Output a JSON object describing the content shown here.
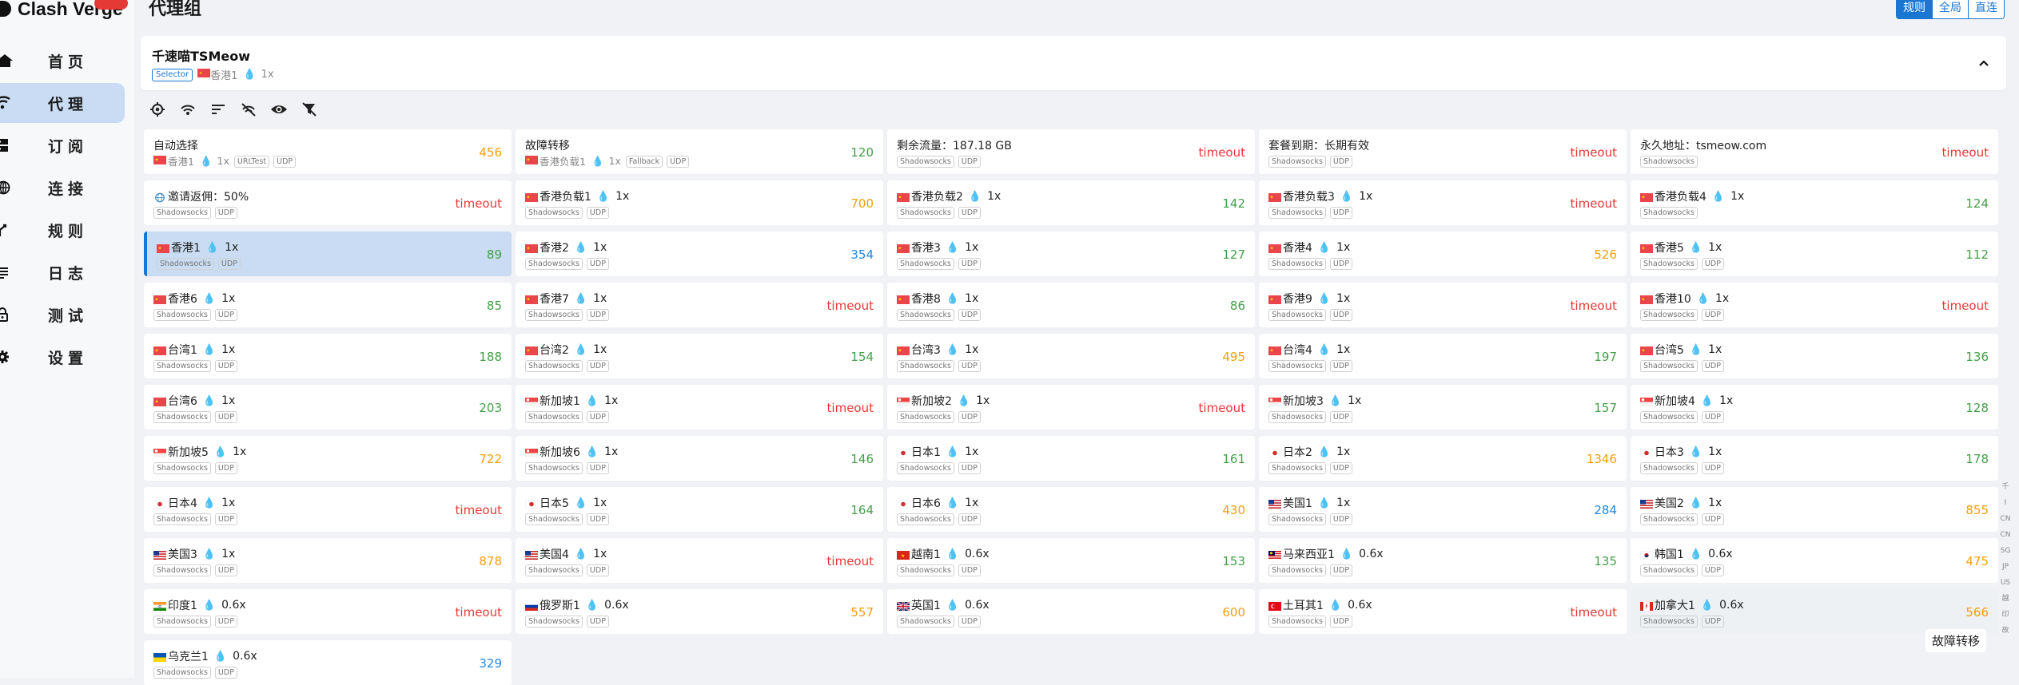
{
  "app": {
    "name": "Clash Verge"
  },
  "header": {
    "title": "代理组"
  },
  "mode_switch": [
    {
      "label": "规则",
      "active": true
    },
    {
      "label": "全局",
      "active": false
    },
    {
      "label": "直连",
      "active": false
    }
  ],
  "nav": [
    {
      "label": "首页",
      "icon": "home-icon",
      "active": false
    },
    {
      "label": "代理",
      "icon": "wifi-icon",
      "active": true
    },
    {
      "label": "订阅",
      "icon": "dns-icon",
      "active": false
    },
    {
      "label": "连接",
      "icon": "language-icon",
      "active": false
    },
    {
      "label": "规则",
      "icon": "fork-icon",
      "active": false
    },
    {
      "label": "日志",
      "icon": "subject-icon",
      "active": false
    },
    {
      "label": "测试",
      "icon": "lock-icon",
      "active": false
    },
    {
      "label": "设置",
      "icon": "gear-icon",
      "active": false
    }
  ],
  "group": {
    "name": "千速喵TSMeow",
    "type": "Selector",
    "current": "香港1",
    "current_flag": "cn",
    "multiplier": "1x"
  },
  "toolbar": [
    "locate-icon",
    "wifi-tethering-icon",
    "sort-icon",
    "hide-icon",
    "eye-icon",
    "filter-off-icon"
  ],
  "colors": {
    "accent": "#1976d2",
    "selected_bg": "#c9dcf3",
    "delay_good": "#43a047",
    "delay_mid": "#f59e0b",
    "delay_timeout": "#e53935",
    "delay_unknown": "#1e88e5"
  },
  "proxies": [
    {
      "name": "自动选择",
      "sub": "香港1",
      "flag": "cn",
      "mult": "1x",
      "tags": [
        "URLTest",
        "UDP"
      ],
      "delay": "456",
      "level": "orange"
    },
    {
      "name": "故障转移",
      "sub": "香港负载1",
      "flag": "cn",
      "mult": "1x",
      "tags": [
        "Fallback",
        "UDP"
      ],
      "delay": "120",
      "level": "green"
    },
    {
      "name": "剩余流量：187.18 GB",
      "flag": "",
      "mult": "",
      "tags": [
        "Shadowsocks",
        "UDP"
      ],
      "delay": "timeout",
      "level": "red"
    },
    {
      "name": "套餐到期：长期有效",
      "flag": "",
      "mult": "",
      "tags": [
        "Shadowsocks",
        "UDP"
      ],
      "delay": "timeout",
      "level": "red"
    },
    {
      "name": "永久地址：tsmeow.com",
      "flag": "",
      "mult": "",
      "tags": [
        "Shadowsocks"
      ],
      "delay": "timeout",
      "level": "red"
    },
    {
      "name": "邀请返佣：50%",
      "flag": "globe",
      "mult": "",
      "tags": [
        "Shadowsocks",
        "UDP"
      ],
      "delay": "timeout",
      "level": "red"
    },
    {
      "name": "香港负载1",
      "flag": "cn",
      "mult": "1x",
      "tags": [
        "Shadowsocks",
        "UDP"
      ],
      "delay": "700",
      "level": "orange"
    },
    {
      "name": "香港负载2",
      "flag": "cn",
      "mult": "1x",
      "tags": [
        "Shadowsocks",
        "UDP"
      ],
      "delay": "142",
      "level": "green"
    },
    {
      "name": "香港负载3",
      "flag": "cn",
      "mult": "1x",
      "tags": [
        "Shadowsocks",
        "UDP"
      ],
      "delay": "timeout",
      "level": "red"
    },
    {
      "name": "香港负载4",
      "flag": "cn",
      "mult": "1x",
      "tags": [
        "Shadowsocks"
      ],
      "delay": "124",
      "level": "green"
    },
    {
      "name": "香港1",
      "flag": "cn",
      "mult": "1x",
      "tags": [
        "Shadowsocks",
        "UDP"
      ],
      "delay": "89",
      "level": "green",
      "selected": true
    },
    {
      "name": "香港2",
      "flag": "cn",
      "mult": "1x",
      "tags": [
        "Shadowsocks",
        "UDP"
      ],
      "delay": "354",
      "level": "blue"
    },
    {
      "name": "香港3",
      "flag": "cn",
      "mult": "1x",
      "tags": [
        "Shadowsocks",
        "UDP"
      ],
      "delay": "127",
      "level": "green"
    },
    {
      "name": "香港4",
      "flag": "cn",
      "mult": "1x",
      "tags": [
        "Shadowsocks",
        "UDP"
      ],
      "delay": "526",
      "level": "orange"
    },
    {
      "name": "香港5",
      "flag": "cn",
      "mult": "1x",
      "tags": [
        "Shadowsocks",
        "UDP"
      ],
      "delay": "112",
      "level": "green"
    },
    {
      "name": "香港6",
      "flag": "cn",
      "mult": "1x",
      "tags": [
        "Shadowsocks",
        "UDP"
      ],
      "delay": "85",
      "level": "green"
    },
    {
      "name": "香港7",
      "flag": "cn",
      "mult": "1x",
      "tags": [
        "Shadowsocks",
        "UDP"
      ],
      "delay": "timeout",
      "level": "red"
    },
    {
      "name": "香港8",
      "flag": "cn",
      "mult": "1x",
      "tags": [
        "Shadowsocks",
        "UDP"
      ],
      "delay": "86",
      "level": "green"
    },
    {
      "name": "香港9",
      "flag": "cn",
      "mult": "1x",
      "tags": [
        "Shadowsocks",
        "UDP"
      ],
      "delay": "timeout",
      "level": "red"
    },
    {
      "name": "香港10",
      "flag": "cn",
      "mult": "1x",
      "tags": [
        "Shadowsocks",
        "UDP"
      ],
      "delay": "timeout",
      "level": "red"
    },
    {
      "name": "台湾1",
      "flag": "cn",
      "mult": "1x",
      "tags": [
        "Shadowsocks",
        "UDP"
      ],
      "delay": "188",
      "level": "green"
    },
    {
      "name": "台湾2",
      "flag": "cn",
      "mult": "1x",
      "tags": [
        "Shadowsocks",
        "UDP"
      ],
      "delay": "154",
      "level": "green"
    },
    {
      "name": "台湾3",
      "flag": "cn",
      "mult": "1x",
      "tags": [
        "Shadowsocks",
        "UDP"
      ],
      "delay": "495",
      "level": "orange"
    },
    {
      "name": "台湾4",
      "flag": "cn",
      "mult": "1x",
      "tags": [
        "Shadowsocks",
        "UDP"
      ],
      "delay": "197",
      "level": "green"
    },
    {
      "name": "台湾5",
      "flag": "cn",
      "mult": "1x",
      "tags": [
        "Shadowsocks",
        "UDP"
      ],
      "delay": "136",
      "level": "green"
    },
    {
      "name": "台湾6",
      "flag": "cn",
      "mult": "1x",
      "tags": [
        "Shadowsocks",
        "UDP"
      ],
      "delay": "203",
      "level": "green"
    },
    {
      "name": "新加坡1",
      "flag": "sg",
      "mult": "1x",
      "tags": [
        "Shadowsocks",
        "UDP"
      ],
      "delay": "timeout",
      "level": "red"
    },
    {
      "name": "新加坡2",
      "flag": "sg",
      "mult": "1x",
      "tags": [
        "Shadowsocks",
        "UDP"
      ],
      "delay": "timeout",
      "level": "red"
    },
    {
      "name": "新加坡3",
      "flag": "sg",
      "mult": "1x",
      "tags": [
        "Shadowsocks",
        "UDP"
      ],
      "delay": "157",
      "level": "green"
    },
    {
      "name": "新加坡4",
      "flag": "sg",
      "mult": "1x",
      "tags": [
        "Shadowsocks",
        "UDP"
      ],
      "delay": "128",
      "level": "green"
    },
    {
      "name": "新加坡5",
      "flag": "sg",
      "mult": "1x",
      "tags": [
        "Shadowsocks",
        "UDP"
      ],
      "delay": "722",
      "level": "orange"
    },
    {
      "name": "新加坡6",
      "flag": "sg",
      "mult": "1x",
      "tags": [
        "Shadowsocks",
        "UDP"
      ],
      "delay": "146",
      "level": "green"
    },
    {
      "name": "日本1",
      "flag": "jp",
      "mult": "1x",
      "tags": [
        "Shadowsocks",
        "UDP"
      ],
      "delay": "161",
      "level": "green"
    },
    {
      "name": "日本2",
      "flag": "jp",
      "mult": "1x",
      "tags": [
        "Shadowsocks",
        "UDP"
      ],
      "delay": "1346",
      "level": "orange"
    },
    {
      "name": "日本3",
      "flag": "jp",
      "mult": "1x",
      "tags": [
        "Shadowsocks",
        "UDP"
      ],
      "delay": "178",
      "level": "green"
    },
    {
      "name": "日本4",
      "flag": "jp",
      "mult": "1x",
      "tags": [
        "Shadowsocks",
        "UDP"
      ],
      "delay": "timeout",
      "level": "red"
    },
    {
      "name": "日本5",
      "flag": "jp",
      "mult": "1x",
      "tags": [
        "Shadowsocks",
        "UDP"
      ],
      "delay": "164",
      "level": "green"
    },
    {
      "name": "日本6",
      "flag": "jp",
      "mult": "1x",
      "tags": [
        "Shadowsocks",
        "UDP"
      ],
      "delay": "430",
      "level": "orange"
    },
    {
      "name": "美国1",
      "flag": "us",
      "mult": "1x",
      "tags": [
        "Shadowsocks",
        "UDP"
      ],
      "delay": "284",
      "level": "blue"
    },
    {
      "name": "美国2",
      "flag": "us",
      "mult": "1x",
      "tags": [
        "Shadowsocks",
        "UDP"
      ],
      "delay": "855",
      "level": "orange"
    },
    {
      "name": "美国3",
      "flag": "us",
      "mult": "1x",
      "tags": [
        "Shadowsocks",
        "UDP"
      ],
      "delay": "878",
      "level": "orange"
    },
    {
      "name": "美国4",
      "flag": "us",
      "mult": "1x",
      "tags": [
        "Shadowsocks",
        "UDP"
      ],
      "delay": "timeout",
      "level": "red"
    },
    {
      "name": "越南1",
      "flag": "vn",
      "mult": "0.6x",
      "tags": [
        "Shadowsocks",
        "UDP"
      ],
      "delay": "153",
      "level": "green"
    },
    {
      "name": "马来西亚1",
      "flag": "my",
      "mult": "0.6x",
      "tags": [
        "Shadowsocks",
        "UDP"
      ],
      "delay": "135",
      "level": "green"
    },
    {
      "name": "韩国1",
      "flag": "kr",
      "mult": "0.6x",
      "tags": [
        "Shadowsocks",
        "UDP"
      ],
      "delay": "475",
      "level": "orange"
    },
    {
      "name": "印度1",
      "flag": "in",
      "mult": "0.6x",
      "tags": [
        "Shadowsocks",
        "UDP"
      ],
      "delay": "timeout",
      "level": "red"
    },
    {
      "name": "俄罗斯1",
      "flag": "ru",
      "mult": "0.6x",
      "tags": [
        "Shadowsocks",
        "UDP"
      ],
      "delay": "557",
      "level": "orange"
    },
    {
      "name": "英国1",
      "flag": "gb",
      "mult": "0.6x",
      "tags": [
        "Shadowsocks",
        "UDP"
      ],
      "delay": "600",
      "level": "orange"
    },
    {
      "name": "土耳其1",
      "flag": "tr",
      "mult": "0.6x",
      "tags": [
        "Shadowsocks",
        "UDP"
      ],
      "delay": "timeout",
      "level": "red"
    },
    {
      "name": "加拿大1",
      "flag": "ca",
      "mult": "0.6x",
      "tags": [
        "Shadowsocks",
        "UDP"
      ],
      "delay": "566",
      "level": "orange",
      "hover": true
    },
    {
      "name": "乌克兰1",
      "flag": "ua",
      "mult": "0.6x",
      "tags": [
        "Shadowsocks",
        "UDP"
      ],
      "delay": "329",
      "level": "blue"
    }
  ],
  "index_bar": [
    "千",
    "I",
    "CN",
    "CN",
    "SG",
    "JP",
    "US",
    "越",
    "印",
    "故"
  ],
  "tooltip": "故障转移"
}
